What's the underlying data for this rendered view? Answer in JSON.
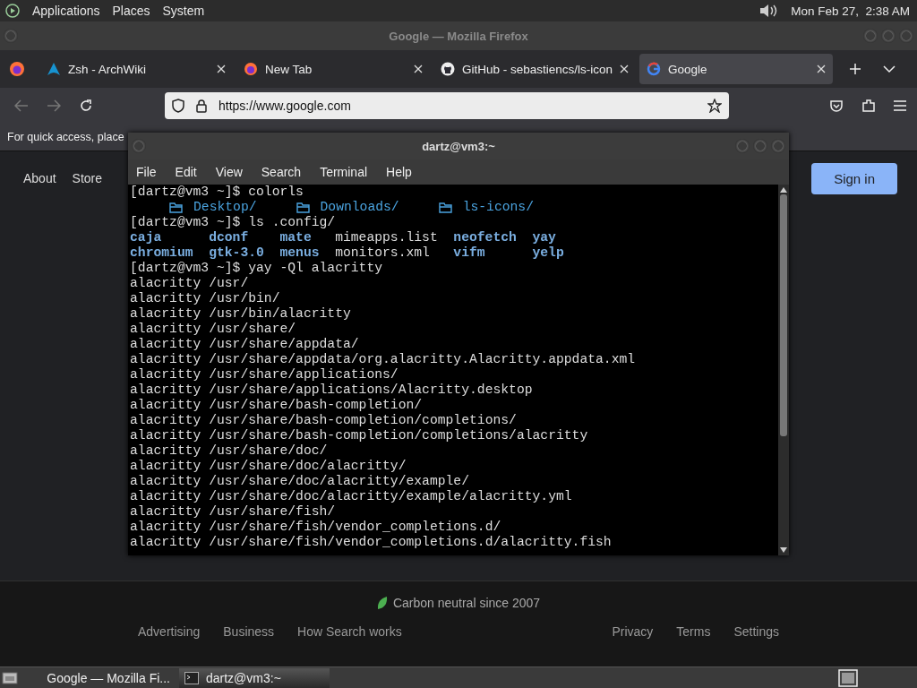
{
  "top_panel": {
    "menus": [
      "Applications",
      "Places",
      "System"
    ],
    "clock": "Mon Feb 27,  2:38 AM"
  },
  "browser": {
    "title": "Google — Mozilla Firefox",
    "tabs": [
      {
        "label": "Zsh - ArchWiki",
        "kind": "arch",
        "selected": false
      },
      {
        "label": "New Tab",
        "kind": "firefox",
        "selected": false
      },
      {
        "label": "GitHub - sebastiencs/ls-icon",
        "kind": "github",
        "selected": false
      },
      {
        "label": "Google",
        "kind": "google",
        "selected": true
      }
    ],
    "url": "https://www.google.com",
    "bookmarks_hint": "For quick access, place",
    "page": {
      "top_links": [
        "About",
        "Store"
      ],
      "sign_in": "Sign in",
      "carbon": "Carbon neutral since 2007",
      "footer_left": [
        "Advertising",
        "Business",
        "How Search works"
      ],
      "footer_right": [
        "Privacy",
        "Terms",
        "Settings"
      ]
    }
  },
  "terminal": {
    "title": "dartz@vm3:~",
    "menu": [
      "File",
      "Edit",
      "View",
      "Search",
      "Terminal",
      "Help"
    ],
    "lines": [
      {
        "kind": "prompt",
        "text": "[dartz@vm3 ~]$ colorls"
      },
      {
        "kind": "folders",
        "entries": [
          "Desktop/",
          "Downloads/",
          "ls-icons/"
        ]
      },
      {
        "kind": "prompt",
        "text": "[dartz@vm3 ~]$ ls .config/"
      },
      {
        "kind": "listing",
        "entries": [
          {
            "name": "caja",
            "dir": true
          },
          {
            "name": "dconf",
            "dir": true
          },
          {
            "name": "mate",
            "dir": true
          },
          {
            "name": "mimeapps.list",
            "dir": false
          },
          {
            "name": "neofetch",
            "dir": true
          },
          {
            "name": "yay",
            "dir": true
          },
          {
            "name": "chromium",
            "dir": true
          },
          {
            "name": "gtk-3.0",
            "dir": true
          },
          {
            "name": "menus",
            "dir": true
          },
          {
            "name": "monitors.xml",
            "dir": false
          },
          {
            "name": "vifm",
            "dir": true
          },
          {
            "name": "yelp",
            "dir": true
          }
        ]
      },
      {
        "kind": "prompt",
        "text": "[dartz@vm3 ~]$ yay -Ql alacritty"
      },
      {
        "kind": "output",
        "text": "alacritty /usr/"
      },
      {
        "kind": "output",
        "text": "alacritty /usr/bin/"
      },
      {
        "kind": "output",
        "text": "alacritty /usr/bin/alacritty"
      },
      {
        "kind": "output",
        "text": "alacritty /usr/share/"
      },
      {
        "kind": "output",
        "text": "alacritty /usr/share/appdata/"
      },
      {
        "kind": "output",
        "text": "alacritty /usr/share/appdata/org.alacritty.Alacritty.appdata.xml"
      },
      {
        "kind": "output",
        "text": "alacritty /usr/share/applications/"
      },
      {
        "kind": "output",
        "text": "alacritty /usr/share/applications/Alacritty.desktop"
      },
      {
        "kind": "output",
        "text": "alacritty /usr/share/bash-completion/"
      },
      {
        "kind": "output",
        "text": "alacritty /usr/share/bash-completion/completions/"
      },
      {
        "kind": "output",
        "text": "alacritty /usr/share/bash-completion/completions/alacritty"
      },
      {
        "kind": "output",
        "text": "alacritty /usr/share/doc/"
      },
      {
        "kind": "output",
        "text": "alacritty /usr/share/doc/alacritty/"
      },
      {
        "kind": "output",
        "text": "alacritty /usr/share/doc/alacritty/example/"
      },
      {
        "kind": "output",
        "text": "alacritty /usr/share/doc/alacritty/example/alacritty.yml"
      },
      {
        "kind": "output",
        "text": "alacritty /usr/share/fish/"
      },
      {
        "kind": "output",
        "text": "alacritty /usr/share/fish/vendor_completions.d/"
      },
      {
        "kind": "output",
        "text": "alacritty /usr/share/fish/vendor_completions.d/alacritty.fish"
      }
    ]
  },
  "taskbar": {
    "tasks": [
      {
        "label": "Google — Mozilla Fi...",
        "kind": "firefox",
        "selected": false
      },
      {
        "label": "dartz@vm3:~",
        "kind": "terminal",
        "selected": true
      }
    ]
  }
}
